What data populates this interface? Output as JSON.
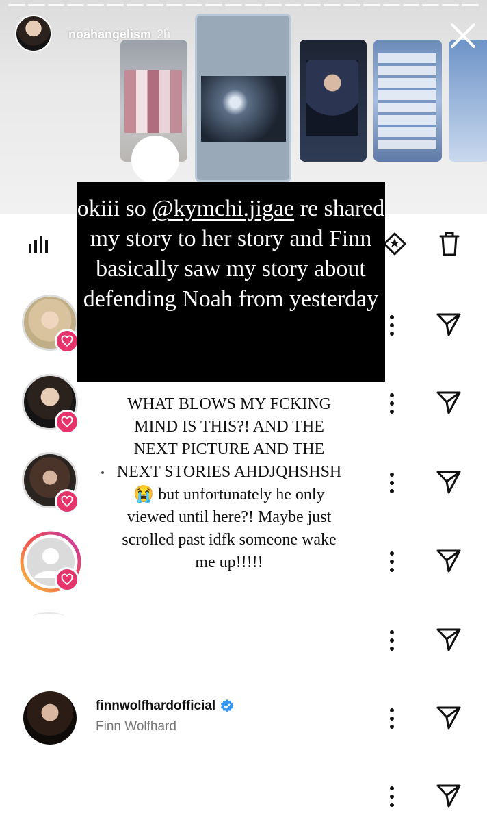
{
  "header": {
    "username": "noahangelism",
    "time": "2h"
  },
  "overlay": {
    "caption_before": "okiii so ",
    "mention": "@kymchi.jigae",
    "caption_after": "  re shared my story to her story and Finn basically saw my story about defending Noah from yesterday",
    "body": "WHAT BLOWS MY FCKING MIND IS THIS?! AND THE NEXT PICTURE AND THE NEXT STORIES AHDJQHSHSH 😭 but unfortunately he only viewed until here?! Maybe just scrolled past idfk someone wake me up!!!!!"
  },
  "viewer": {
    "username": "finnwolfhardofficial",
    "full_name": "Finn Wolfhard",
    "verified": true
  },
  "colors": {
    "heart_badge": "#e6336c",
    "verified_blue": "#3897f0",
    "story_ring": "#f58529"
  },
  "icons": [
    "close-icon",
    "stats-icon",
    "highlight-icon",
    "trash-icon",
    "more-icon",
    "send-icon",
    "heart-icon",
    "verified-icon"
  ]
}
